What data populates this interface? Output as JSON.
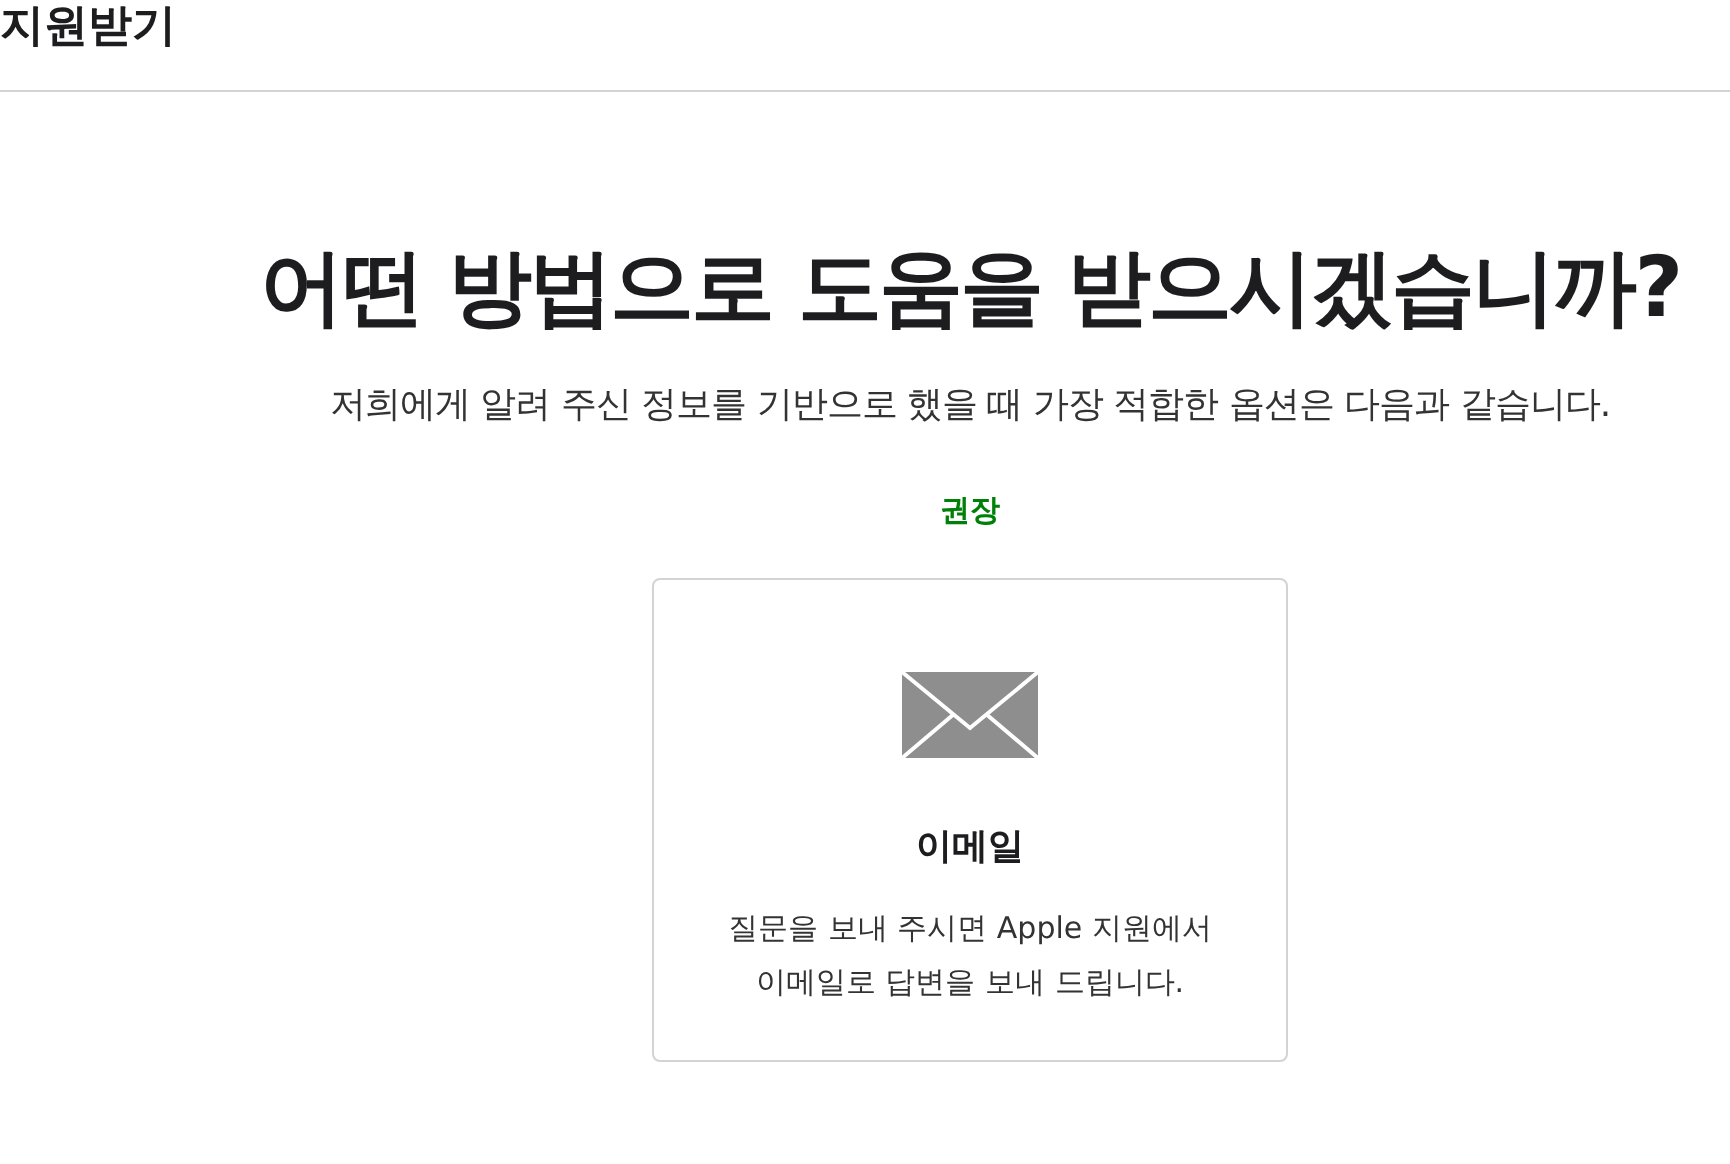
{
  "header": {
    "title": "지원받기"
  },
  "heading": "어떤 방법으로 도움을 받으시겠습니까?",
  "subheading": "저희에게 알려 주신 정보를 기반으로 했을 때 가장 적합한 옵션은 다음과 같습니다.",
  "recommendation_label": "권장",
  "options": [
    {
      "kind": "email",
      "title": "이메일",
      "description_lines": [
        "질문을 보내 주시면 Apple 지원에서",
        "이메일로 답변을 보내 드립니다."
      ]
    }
  ]
}
